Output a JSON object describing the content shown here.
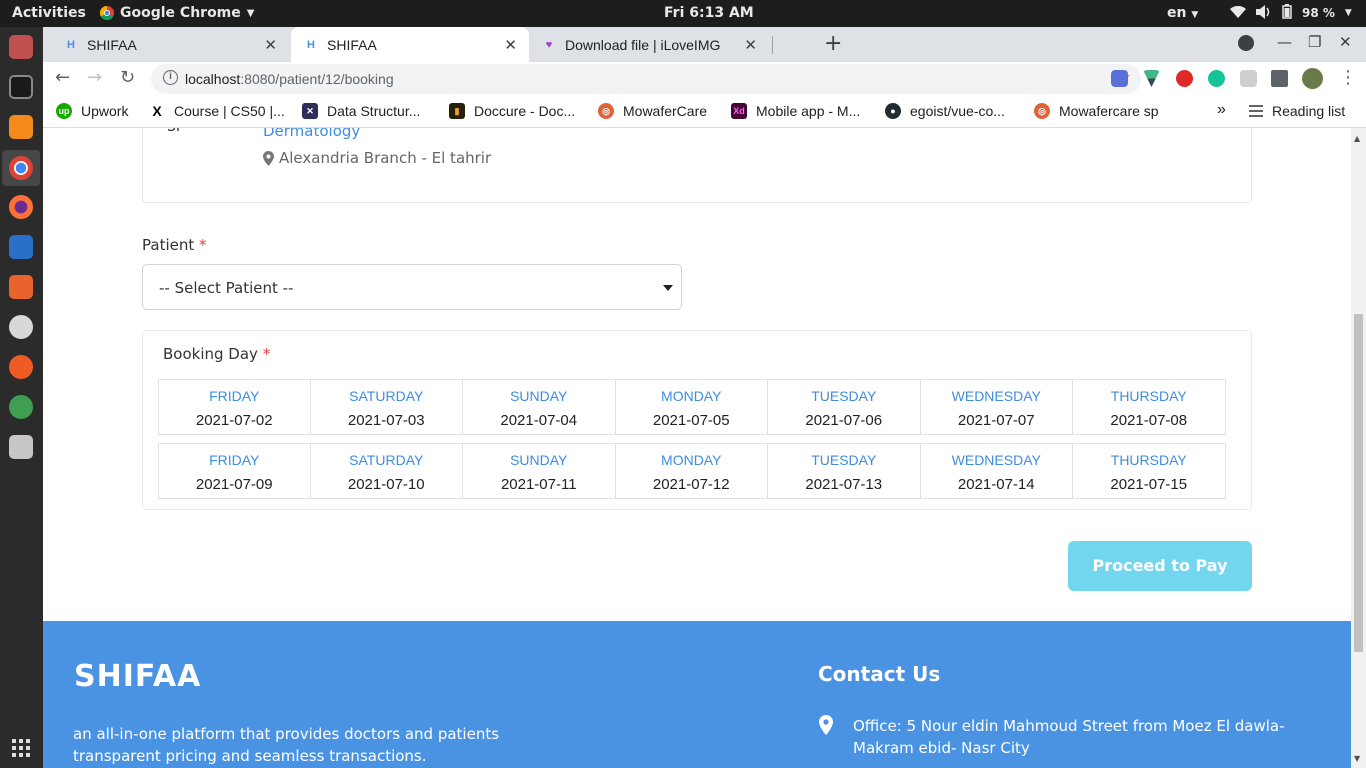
{
  "system_bar": {
    "activities": "Activities",
    "app_name": "Google Chrome",
    "clock": "Fri  6:13 AM",
    "language": "en",
    "battery": "98 %"
  },
  "browser": {
    "tabs": [
      {
        "title": "SHIFAA",
        "active": false
      },
      {
        "title": "SHIFAA",
        "active": true
      },
      {
        "title": "Download file | iLoveIMG",
        "active": false
      }
    ],
    "url_host": "localhost",
    "url_path": ":8080/patient/12/booking",
    "bookmarks": [
      "Upwork",
      "Course | CS50 |...",
      "Data Structur...",
      "Doccure - Doc...",
      "MowaferCare",
      "Mobile app - M...",
      "egoist/vue-co...",
      "Mowafercare sp"
    ],
    "more_bookmarks": "»",
    "reading_list": "Reading list"
  },
  "doctor_card": {
    "title_suffix": "SP",
    "specialty": "Dermatology",
    "branch": "Alexandria Branch - El tahrir"
  },
  "patient": {
    "label": "Patient",
    "required_mark": "*",
    "select_value": "-- Select Patient --"
  },
  "booking": {
    "label": "Booking Day",
    "required_mark": "*",
    "week1": [
      {
        "day": "FRIDAY",
        "date": "2021-07-02"
      },
      {
        "day": "SATURDAY",
        "date": "2021-07-03"
      },
      {
        "day": "SUNDAY",
        "date": "2021-07-04"
      },
      {
        "day": "MONDAY",
        "date": "2021-07-05"
      },
      {
        "day": "TUESDAY",
        "date": "2021-07-06"
      },
      {
        "day": "WEDNESDAY",
        "date": "2021-07-07"
      },
      {
        "day": "THURSDAY",
        "date": "2021-07-08"
      }
    ],
    "week2": [
      {
        "day": "FRIDAY",
        "date": "2021-07-09"
      },
      {
        "day": "SATURDAY",
        "date": "2021-07-10"
      },
      {
        "day": "SUNDAY",
        "date": "2021-07-11"
      },
      {
        "day": "MONDAY",
        "date": "2021-07-12"
      },
      {
        "day": "TUESDAY",
        "date": "2021-07-13"
      },
      {
        "day": "WEDNESDAY",
        "date": "2021-07-14"
      },
      {
        "day": "THURSDAY",
        "date": "2021-07-15"
      }
    ]
  },
  "actions": {
    "proceed_label": "Proceed to Pay"
  },
  "footer": {
    "logo": "SHIFAA",
    "tagline": "an all-in-one platform that provides doctors and patients transparent pricing and seamless transactions.",
    "contact_title": "Contact Us",
    "office": "Office: 5 Nour eldin Mahmoud Street from Moez El dawla- Makram ebid- Nasr City"
  },
  "colors": {
    "accent_blue": "#3e8de0",
    "footer_blue": "#4a93e3",
    "pay_button": "#73d6ef",
    "required_red": "#e53e3e"
  }
}
